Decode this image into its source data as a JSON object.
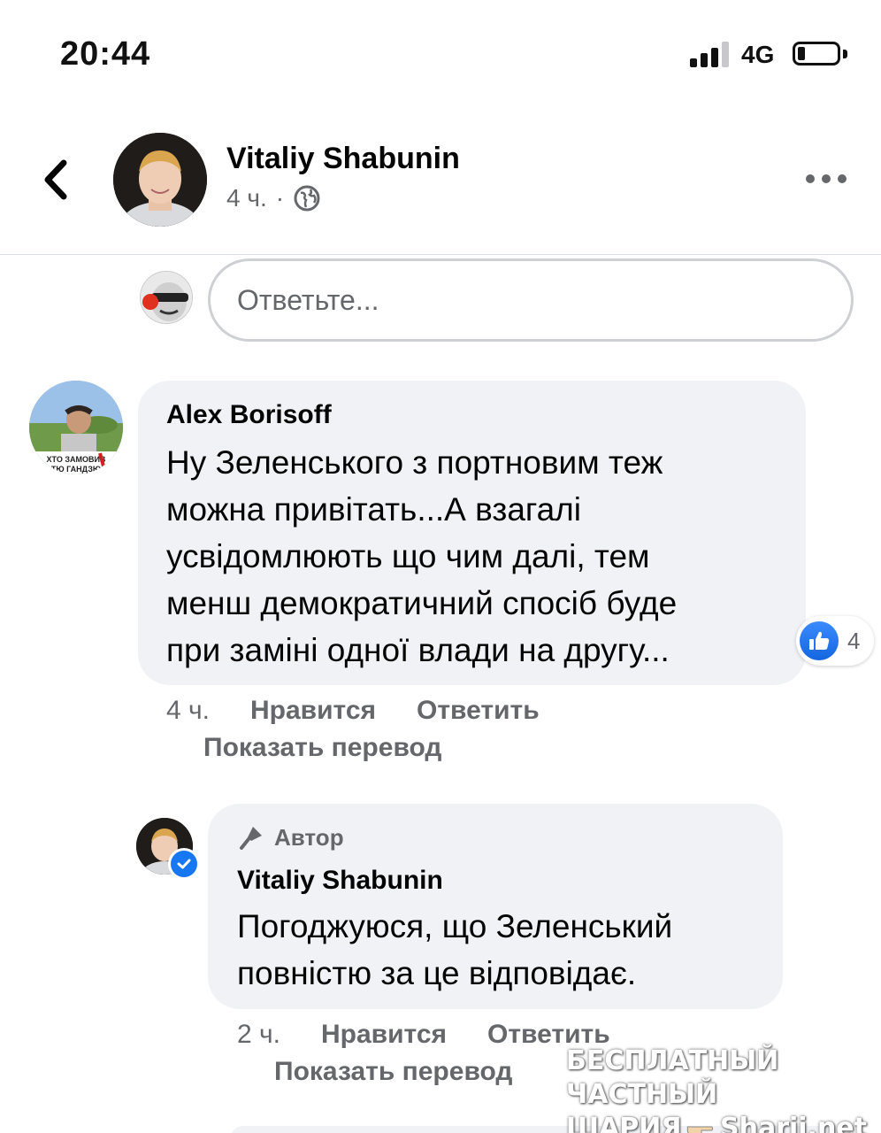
{
  "status_bar": {
    "time": "20:44",
    "network": "4G"
  },
  "post_header": {
    "author_name": "Vitaliy Shabunin",
    "timestamp": "4 ч.",
    "separator": "·",
    "audience_icon": "globe-icon"
  },
  "reply": {
    "placeholder": "Ответьте..."
  },
  "comments": [
    {
      "author": "Alex Borisoff",
      "avatar_caption": "ХТО ЗАМОВИВ ТЮ ГАНДЗЮ",
      "lines": [
        "Ну Зеленського з портновим  теж",
        "можна привітать...А взагалі",
        "усвідомлюють що чим далі, тем",
        "менш демократичний спосіб буде",
        "при заміні одної влади на другу..."
      ],
      "reactions": {
        "icon": "thumbs-up-icon",
        "count": "4"
      },
      "time": "4 ч.",
      "like_label": "Нравится",
      "reply_label": "Ответить",
      "translate_label": "Показать перевод"
    },
    {
      "badge": "Автор",
      "author": "Vitaliy Shabunin",
      "verified": true,
      "lines": [
        "Погоджуюся, що Зеленський",
        "повністю за це відповідає."
      ],
      "time": "2 ч.",
      "like_label": "Нравится",
      "reply_label": "Ответить",
      "translate_label": "Показать перевод"
    }
  ],
  "watermark": {
    "line1": "БЕСПЛАТНЫЙ ЧАСТНЫЙ",
    "line2": "ШАРИЯ",
    "line3": "Sharij.net"
  },
  "colors": {
    "accent": "#1877f2",
    "bubble": "#f0f2f5",
    "secondary_text": "#65676b"
  }
}
